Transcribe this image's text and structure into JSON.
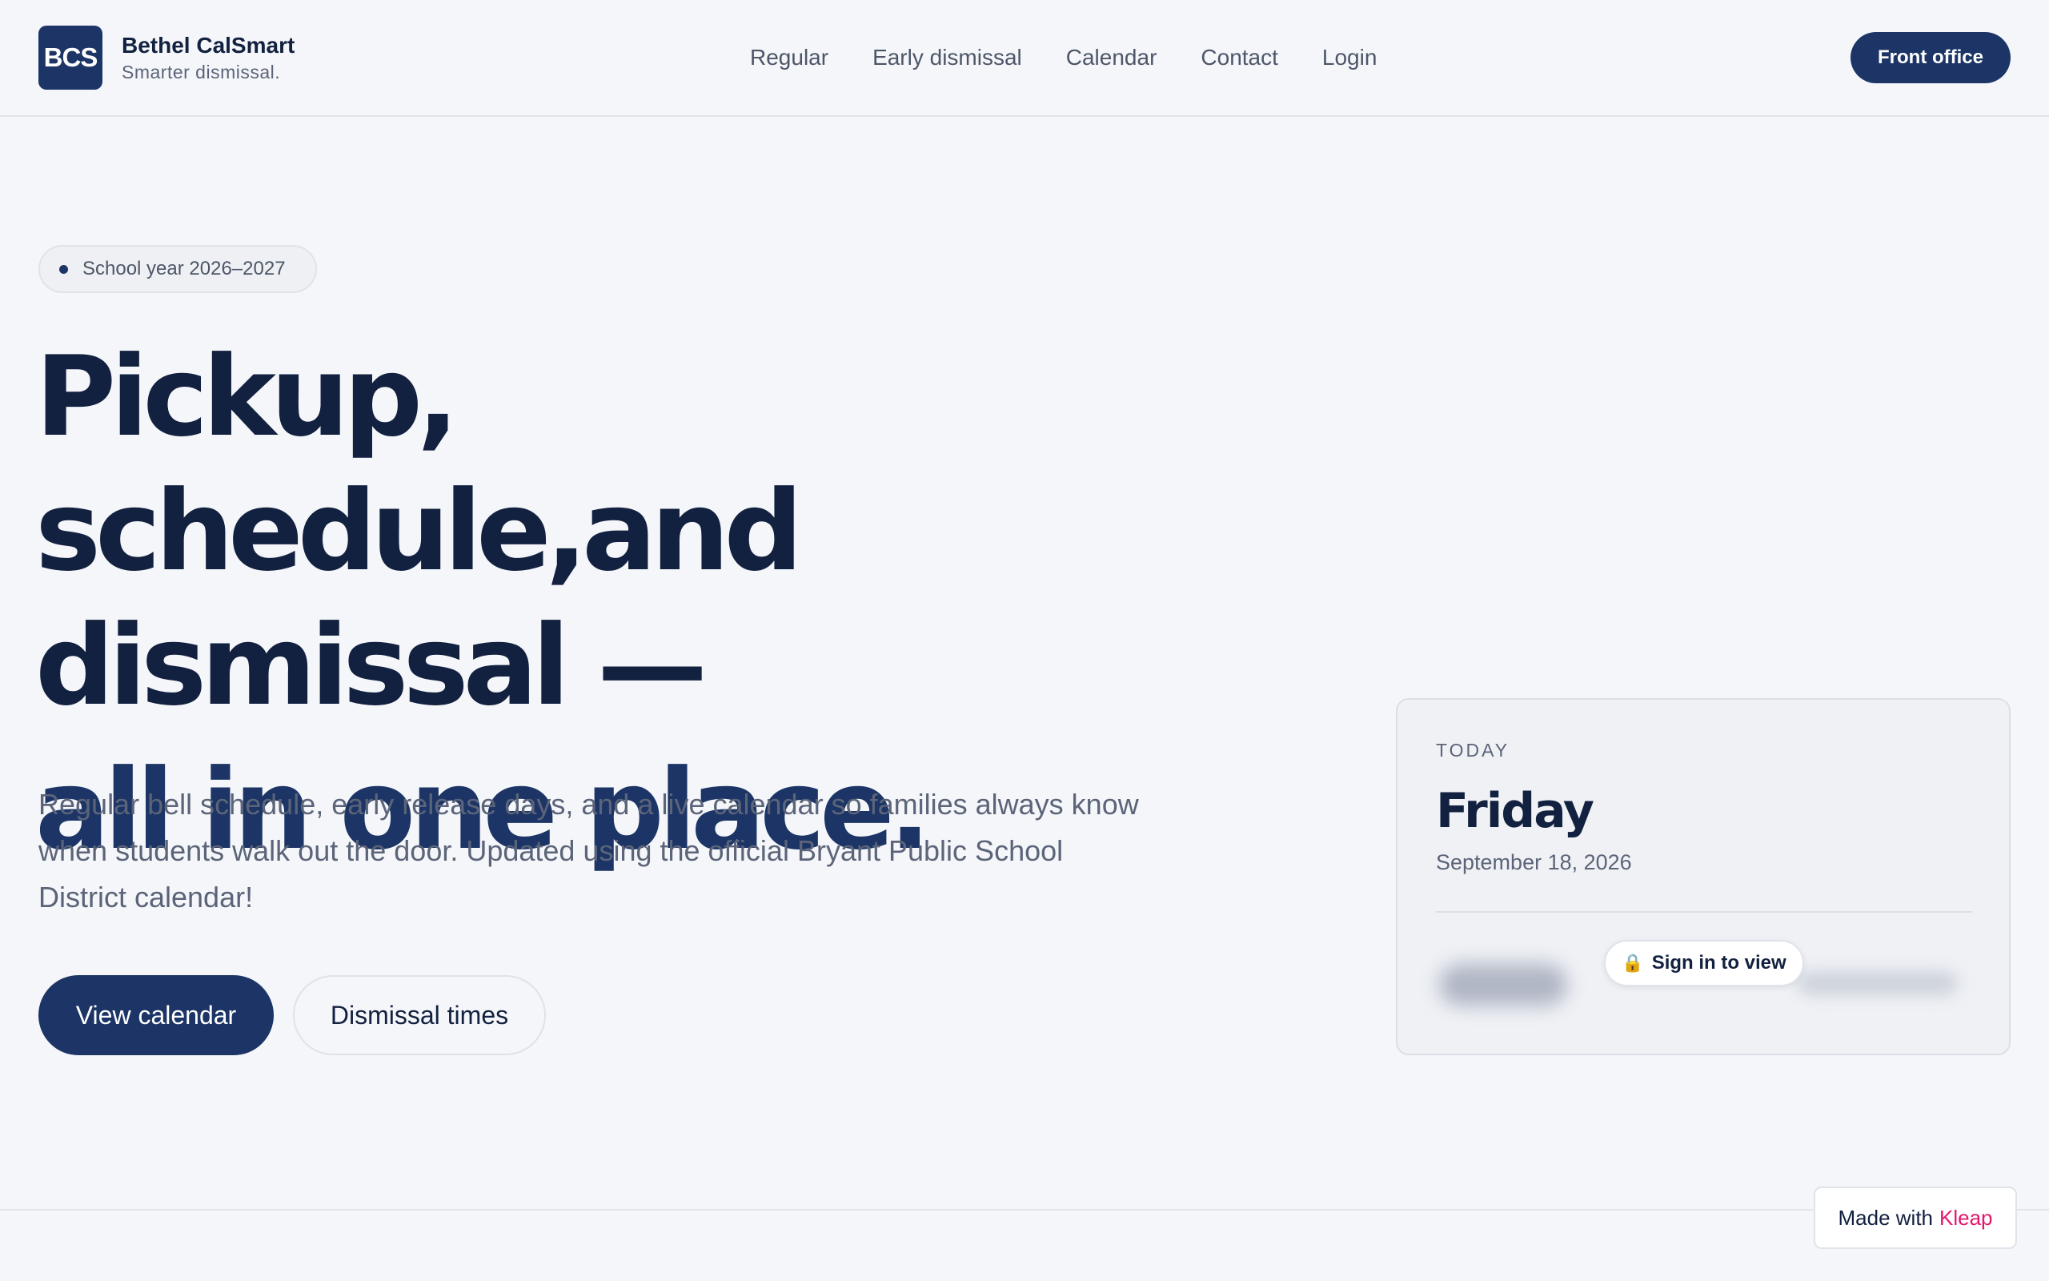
{
  "header": {
    "logo_text": "BCS",
    "brand_name": "Bethel CalSmart",
    "brand_tagline": "Smarter dismissal.",
    "nav": [
      {
        "label": "Regular"
      },
      {
        "label": "Early dismissal"
      },
      {
        "label": "Calendar"
      },
      {
        "label": "Contact"
      },
      {
        "label": "Login"
      }
    ],
    "cta_label": "Front office"
  },
  "hero": {
    "pill_text": "School year 2026–2027",
    "headline_line1": "Pickup, schedule,and",
    "headline_line2": "dismissal —",
    "headline_accent": "all in one place.",
    "lede": "Regular bell schedule, early release days, and a live calendar so families always know when students walk out the door. Updated using the official Bryant Public School District calendar!",
    "primary_button": "View calendar",
    "secondary_button": "Dismissal times"
  },
  "today_card": {
    "label": "TODAY",
    "day": "Friday",
    "date": "September 18, 2026",
    "lock_icon": "🔒",
    "signin_label": "Sign in to view"
  },
  "badge": {
    "prefix": "Made with",
    "brand": "Kleap"
  },
  "colors": {
    "background": "#f5f6fa",
    "primary": "#1c3566",
    "text": "#12213f",
    "muted": "#5b6478",
    "kleap": "#e4166b"
  }
}
